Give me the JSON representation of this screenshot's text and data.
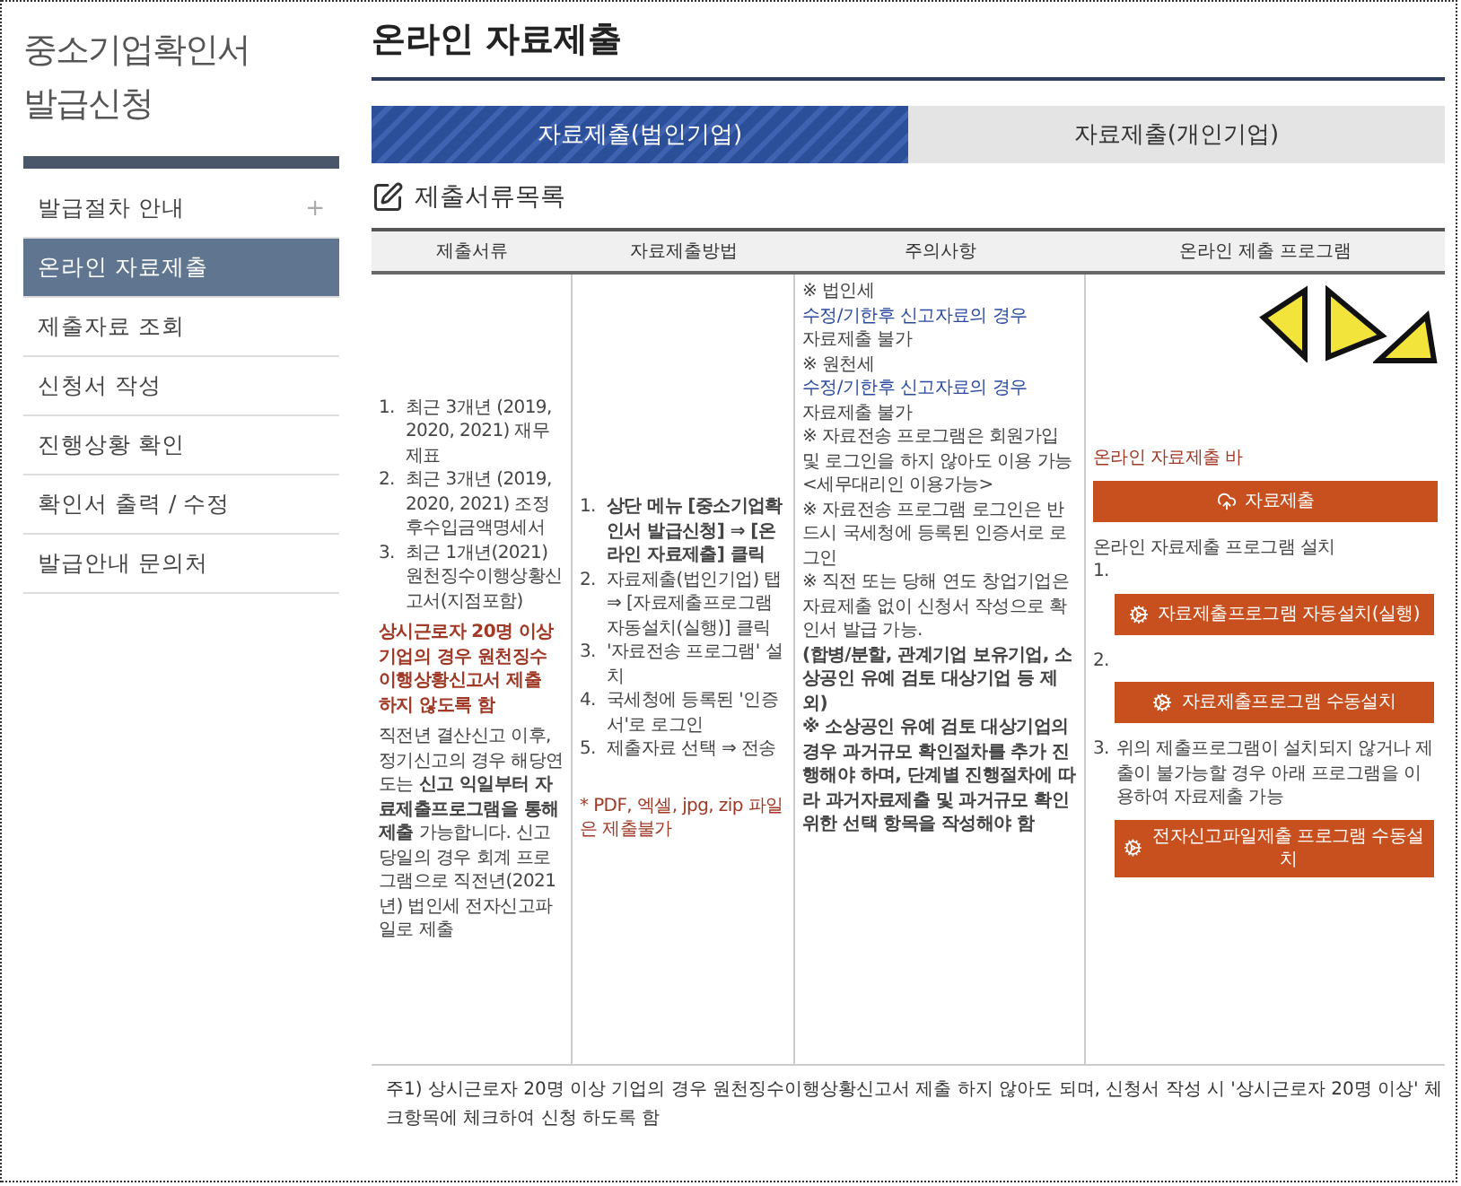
{
  "sidebar": {
    "title_lines": [
      "중소기업확인서",
      "발급신청"
    ],
    "items": [
      {
        "label": "발급절차 안내",
        "selected": false,
        "toggle": "+"
      },
      {
        "label": "온라인 자료제출",
        "selected": true
      },
      {
        "label": "제출자료 조회",
        "selected": false
      },
      {
        "label": "신청서 작성",
        "selected": false
      },
      {
        "label": "진행상황 확인",
        "selected": false
      },
      {
        "label": "확인서 출력 / 수정",
        "selected": false
      },
      {
        "label": "발급안내 문의처",
        "selected": false
      }
    ]
  },
  "page_title": "온라인 자료제출",
  "tabs": [
    {
      "label": "자료제출(법인기업)",
      "selected": true
    },
    {
      "label": "자료제출(개인기업)",
      "selected": false
    }
  ],
  "section_title": "제출서류목록",
  "table": {
    "columns": [
      "제출서류",
      "자료제출방법",
      "주의사항",
      "온라인 제출 프로그램"
    ],
    "documents": {
      "items": [
        {
          "number": "1.",
          "text": "최근 3개년 (2019, 2020, 2021) 재무제표"
        },
        {
          "number": "2.",
          "text": "최근 3개년 (2019, 2020, 2021) 조정후수입금액명세서"
        },
        {
          "number": "3.",
          "text": "최근 1개년(2021) 원천징수이행상황신고서(지점포함)"
        }
      ],
      "warning": "상시근로자 20명 이상 기업의 경우 원천징수이행상황신고서 제출 하지 않도록 함",
      "note": "직전년 결산신고 이후, 정기신고의 경우 해당연도는 **신고 익일부터 자료제출프로그램을 통해 제출** 가능합니다. 신고 당일의 경우 회계 프로그램으로 직전년(2021년) 법인세 전자신고파일로 제출"
    },
    "method": {
      "steps": [
        {
          "number": "1.",
          "text": "상단 메뉴 [중소기업확인서 발급신청] ⇒ [온라인 자료제출] 클릭",
          "bold": true
        },
        {
          "number": "2.",
          "text": "자료제출(법인기업) 탭 ⇒ [자료제출프로그램 자동설치(실행)] 클릭",
          "bold": false
        },
        {
          "number": "3.",
          "text": "'자료전송 프로그램' 설치",
          "bold": false
        },
        {
          "number": "4.",
          "text": "국세청에 등록된 '인증서'로 로그인",
          "bold": false
        },
        {
          "number": "5.",
          "text": "제출자료 선택 ⇒ 전송",
          "bold": false
        }
      ],
      "note": "* PDF, 엑셀, jpg, zip 파일은 제출불가"
    },
    "cautions": [
      {
        "kind": "plain",
        "text": "※ 법인세"
      },
      {
        "kind": "blue",
        "text": "수정/기한후 신고자료의 경우"
      },
      {
        "kind": "plain",
        "text": "자료제출 불가"
      },
      {
        "kind": "plain",
        "text": "※ 원천세"
      },
      {
        "kind": "blue",
        "text": "수정/기한후 신고자료의 경우"
      },
      {
        "kind": "plain",
        "text": "자료제출 불가"
      },
      {
        "kind": "plain",
        "text": "※ 자료전송 프로그램은 회원가입 및 로그인을 하지 않아도 이용 가능 <세무대리인 이용가능>"
      },
      {
        "kind": "plain",
        "text": "※ 자료전송 프로그램 로그인은 반드시 국세청에 등록된 인증서로 로그인"
      },
      {
        "kind": "plain",
        "text": "※ 직전 또는 당해 연도 창업기업은 자료제출 없이 신청서 작성으로 확인서 발급 가능."
      },
      {
        "kind": "bold",
        "text": "(합병/분할, 관계기업 보유기업, 소상공인 유예 검토 대상기업 등 제외)"
      },
      {
        "kind": "bold",
        "text": "※ 소상공인 유예 검토 대상기업의 경우 과거규모 확인절차를 추가 진행해야 하며, 단계별 진행절차에 따라 과거자료제출 및 과거규모 확인 위한 선택 항목을 작성해야 함"
      }
    ],
    "program": {
      "link_text": "온라인 자료제출 바",
      "submit_button": "자료제출",
      "install_title": "온라인 자료제출 프로그램 설치",
      "steps": [
        {
          "number": "1.",
          "button": "자료제출프로그램 자동설치(실행)"
        },
        {
          "number": "2.",
          "button": "자료제출프로그램 수동설치"
        },
        {
          "number": "3.",
          "text": "위의 제출프로그램이 설치되지 않거나 제출이 불가능할 경우 아래 프로그램을 이용하여 자료제출 가능",
          "button": "전자신고파일제출 프로그램 수동설치"
        }
      ]
    }
  },
  "footnote": "주1) 상시근로자 20명 이상 기업의 경우 원천징수이행상황신고서 제출 하지 않아도 되며, 신청서 작성 시 '상시근로자 20명 이상' 체크항목에 체크하여 신청 하도록 함"
}
